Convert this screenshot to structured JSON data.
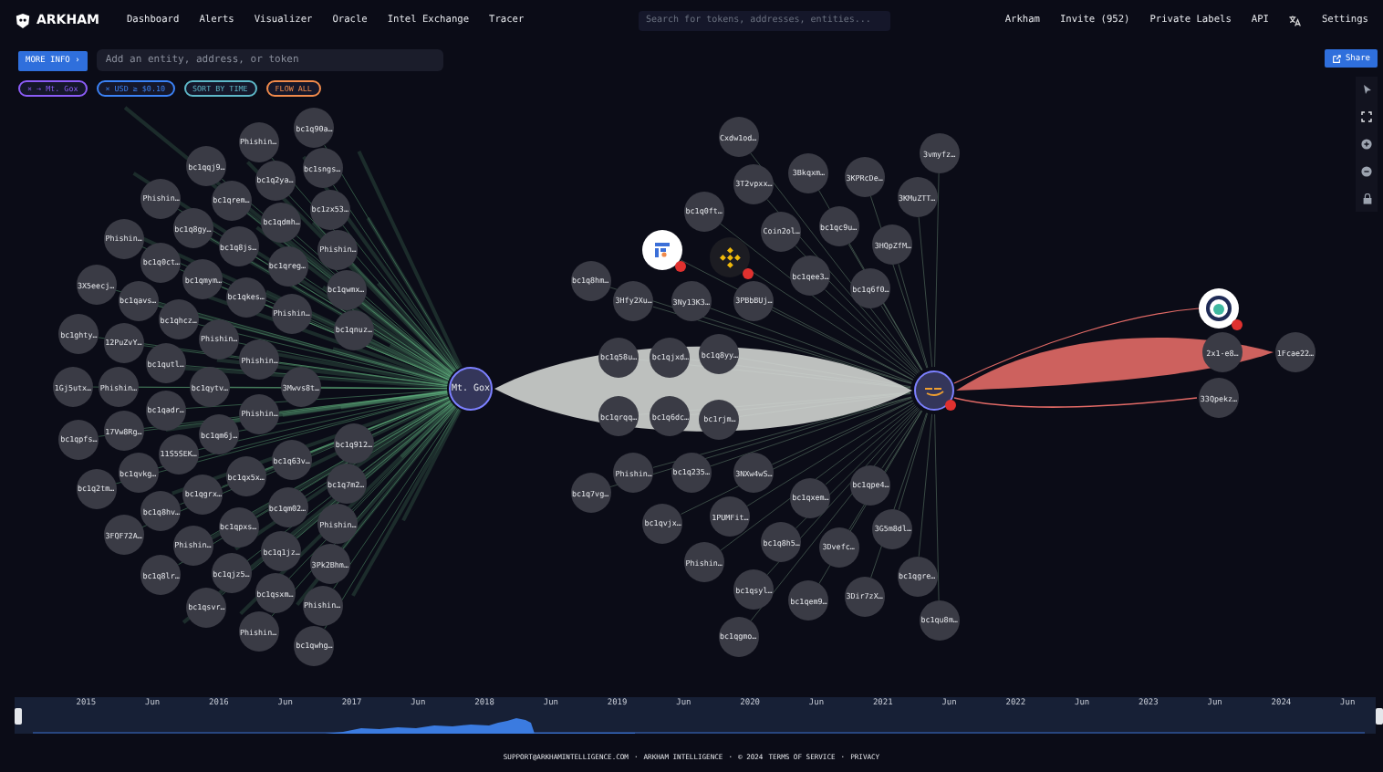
{
  "nav": {
    "brand": "ARKHAM",
    "links": [
      "Dashboard",
      "Alerts",
      "Visualizer",
      "Oracle",
      "Intel Exchange",
      "Tracer"
    ],
    "search": {
      "placeholder": "Search for tokens, addresses, entities..."
    },
    "right_links": [
      "Arkham",
      "Invite (952)",
      "Private Labels",
      "API"
    ],
    "settings": "Settings"
  },
  "toolbar": {
    "more_info": "MORE INFO ›",
    "entity_input": {
      "placeholder": "Add an entity, address, or token"
    },
    "share": "Share"
  },
  "chips": [
    {
      "label": "× → Mt. Gox",
      "color": "#8b5cf6"
    },
    {
      "label": "× USD ≥ $0.10",
      "color": "#3b82f6"
    },
    {
      "label": "SORT BY TIME",
      "color": "#5eb8c8"
    },
    {
      "label": "FLOW ALL",
      "color": "#f08a4b"
    }
  ],
  "left_hub": {
    "label": "Mt. Gox"
  },
  "left_nodes": [
    "bc1q90a…",
    "Phishin…",
    "bc1qqj9…",
    "bc1q2ya…",
    "bc1sngs…",
    "Phishin…",
    "bc1qrem…",
    "bc1q8gy…",
    "bc1qdmh…",
    "bc1zx53…",
    "Phishin…",
    "bc1q8js…",
    "Phishin…",
    "bc1q0ct…",
    "bc1qmym…",
    "bc1qreg…",
    "3X5eecj…",
    "bc1qavs…",
    "bc1qkes…",
    "bc1qwmx…",
    "bc1qhcz…",
    "Phishin…",
    "bc1qnuz…",
    "bc1ghty…",
    "12PuZvY…",
    "Phishin…",
    "bc1qutl…",
    "Phishin…",
    "1Gj5utx…",
    "Phishin…",
    "bc1qadr…",
    "bc1qytv…",
    "3Mwvs8t…",
    "17Vw8Rg…",
    "bc1qm6j…",
    "Phishin…",
    "bc1qpfs…",
    "11S5SEK…",
    "bc1q63v…",
    "bc1q912…",
    "bc1qvkg…",
    "bc1qx5x…",
    "bc1q7m2…",
    "bc1q2tm…",
    "bc1q8hv…",
    "bc1qgrx…",
    "bc1qm02…",
    "3FQF72A…",
    "bc1qpxs…",
    "Phishin…",
    "Phishin…",
    "bc1q1jz…",
    "bc1q8lr…",
    "bc1qjz5…",
    "3Pk2Bhm…",
    "bc1qsvr…",
    "bc1qsxm…",
    "Phishin…",
    "Phishin…",
    "bc1qwhg…"
  ],
  "middle_hub": {
    "kind": "entity"
  },
  "middle_nodes": [
    {
      "kind": "address",
      "label": "Cxdw1od…"
    },
    {
      "kind": "address",
      "label": "3vmyfz…"
    },
    {
      "kind": "address",
      "label": "3Bkqxm…"
    },
    {
      "kind": "address",
      "label": "3KPRcDe…"
    },
    {
      "kind": "address",
      "label": "3T2vpxx…"
    },
    {
      "kind": "address",
      "label": "3KMuZTT…"
    },
    {
      "kind": "address",
      "label": "bc1q0ft…"
    },
    {
      "kind": "address",
      "label": "Coin2ol…"
    },
    {
      "kind": "address",
      "label": "bc1qc9u…"
    },
    {
      "kind": "entity"
    },
    {
      "kind": "entity"
    },
    {
      "kind": "address",
      "label": "3HQpZfM…"
    },
    {
      "kind": "address",
      "label": "bc1q8hm…"
    },
    {
      "kind": "address",
      "label": "bc1qee3…"
    },
    {
      "kind": "address",
      "label": "3Hfy2Xu…"
    },
    {
      "kind": "address",
      "label": "3Ny13K3…"
    },
    {
      "kind": "address",
      "label": "3PBbBUj…"
    },
    {
      "kind": "address",
      "label": "bc1q6f0…"
    },
    {
      "kind": "address",
      "label": "bc1q58u…"
    },
    {
      "kind": "address",
      "label": "bc1qjxd…"
    },
    {
      "kind": "address",
      "label": "bc1q8yy…"
    },
    {
      "kind": "address",
      "label": "bc1qrqq…"
    },
    {
      "kind": "address",
      "label": "bc1q6dc…"
    },
    {
      "kind": "address",
      "label": "bc1rjm…"
    },
    {
      "kind": "address",
      "label": "Phishin…"
    },
    {
      "kind": "address",
      "label": "bc1q235…"
    },
    {
      "kind": "address",
      "label": "3NXw4wS…"
    },
    {
      "kind": "address",
      "label": "bc1qpe4…"
    },
    {
      "kind": "address",
      "label": "bc1q7vg…"
    },
    {
      "kind": "address",
      "label": "bc1qxem…"
    },
    {
      "kind": "address",
      "label": "bc1qvjx…"
    },
    {
      "kind": "address",
      "label": "1PUMFit…"
    },
    {
      "kind": "address",
      "label": "3G5m8dl…"
    },
    {
      "kind": "address",
      "label": "Phishin…"
    },
    {
      "kind": "address",
      "label": "bc1q8h5…"
    },
    {
      "kind": "address",
      "label": "3Dvefc…"
    },
    {
      "kind": "address",
      "label": "bc1qgre…"
    },
    {
      "kind": "address",
      "label": "bc1qsyl…"
    },
    {
      "kind": "address",
      "label": "bc1qem9…"
    },
    {
      "kind": "address",
      "label": "3Dir7zX…"
    },
    {
      "kind": "address",
      "label": "bc1qgmo…"
    },
    {
      "kind": "address",
      "label": "bc1qu8m…"
    }
  ],
  "right_nodes": [
    {
      "kind": "entity"
    },
    {
      "kind": "address",
      "label": "2x1-e8…"
    },
    {
      "kind": "address",
      "label": "1Fcae22…"
    },
    {
      "kind": "address",
      "label": "33Qpekz…"
    }
  ],
  "timeline": {
    "labels": [
      "2015",
      "Jun",
      "2016",
      "Jun",
      "2017",
      "Jun",
      "2018",
      "Jun",
      "2019",
      "Jun",
      "2020",
      "Jun",
      "2021",
      "Jun",
      "2022",
      "Jun",
      "2023",
      "Jun",
      "2024",
      "Jun"
    ]
  },
  "footer": [
    "SUPPORT@ARKHAMINTELLIGENCE.COM",
    "·",
    "ARKHAM INTELLIGENCE",
    "·",
    "© 2024",
    "TERMS OF SERVICE",
    "·",
    "PRIVACY"
  ]
}
